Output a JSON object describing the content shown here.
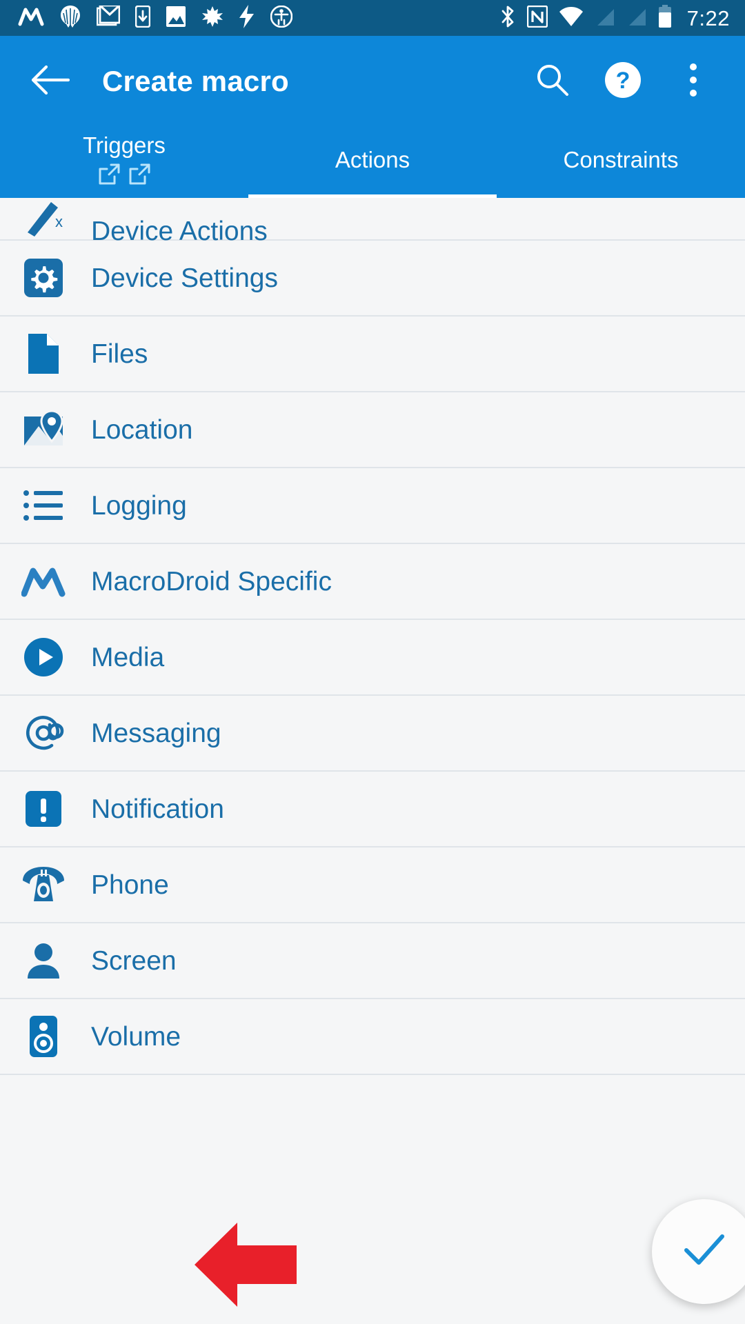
{
  "status_bar": {
    "time": "7:22",
    "left_icons": [
      {
        "name": "macrodroid-icon"
      },
      {
        "name": "magisk-icon"
      },
      {
        "name": "gmail-icon"
      },
      {
        "name": "download-phone-icon"
      },
      {
        "name": "photo-icon"
      },
      {
        "name": "maple-leaf-icon"
      },
      {
        "name": "lightning-bolt-icon"
      },
      {
        "name": "accessibility-icon"
      }
    ],
    "right_icons": [
      {
        "name": "bluetooth-icon"
      },
      {
        "name": "nfc-icon"
      },
      {
        "name": "wifi-icon"
      },
      {
        "name": "signal-off-icon"
      },
      {
        "name": "signal-off-2-icon"
      },
      {
        "name": "battery-icon"
      }
    ]
  },
  "app_bar": {
    "title": "Create macro",
    "back_label": "Back",
    "search_label": "Search",
    "help_label": "Help",
    "overflow_label": "More options"
  },
  "tabs": [
    {
      "id": "triggers",
      "label": "Triggers",
      "selected": false,
      "sub_icons": [
        "open-in-new-icon",
        "open-in-new-icon"
      ]
    },
    {
      "id": "actions",
      "label": "Actions",
      "selected": true,
      "sub_icons": []
    },
    {
      "id": "constraints",
      "label": "Constraints",
      "selected": false,
      "sub_icons": []
    }
  ],
  "list": {
    "items": [
      {
        "label": "Device Actions",
        "icon": "wand-icon",
        "clipped": true
      },
      {
        "label": "Device Settings",
        "icon": "gear-square-icon",
        "clipped": false
      },
      {
        "label": "Files",
        "icon": "file-icon",
        "clipped": false
      },
      {
        "label": "Location",
        "icon": "map-pin-icon",
        "clipped": false
      },
      {
        "label": "Logging",
        "icon": "bullet-list-icon",
        "clipped": false
      },
      {
        "label": "MacroDroid Specific",
        "icon": "macrodroid-logo-icon",
        "clipped": false
      },
      {
        "label": "Media",
        "icon": "play-circle-icon",
        "clipped": false
      },
      {
        "label": "Messaging",
        "icon": "at-sign-icon",
        "clipped": false
      },
      {
        "label": "Notification",
        "icon": "exclamation-square-icon",
        "clipped": false
      },
      {
        "label": "Phone",
        "icon": "rotary-phone-icon",
        "clipped": false
      },
      {
        "label": "Screen",
        "icon": "person-icon",
        "clipped": false
      },
      {
        "label": "Volume",
        "icon": "speaker-icon",
        "clipped": false
      }
    ]
  },
  "annotation": {
    "arrow_color": "#e8202a",
    "points_at": "Volume"
  },
  "fab": {
    "icon": "check-icon",
    "label": "Confirm"
  },
  "colors": {
    "status_bar_bg": "#0d5a86",
    "app_bar_bg": "#0d87d9",
    "list_bg": "#f5f6f7",
    "accent_text": "#1a6ea8",
    "divider": "#dfe4e9",
    "fab_bg": "#fcfcfc",
    "fab_icon": "#1a8fd6"
  }
}
